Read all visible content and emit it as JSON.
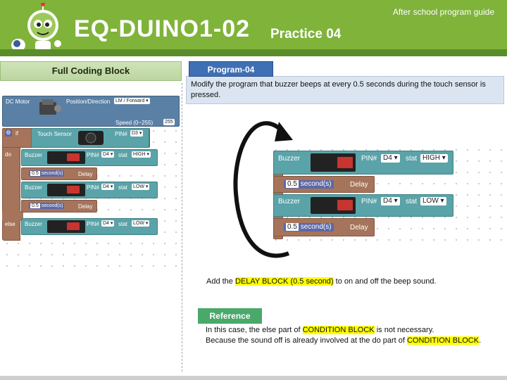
{
  "header": {
    "title": "EQ-DUINO1-02",
    "subtitle": "Practice 04",
    "guide": "After school program guide"
  },
  "left_panel": {
    "tab_label": "Full Coding Block",
    "dc_motor": {
      "label": "DC Motor",
      "pos_label": "Position/Direction",
      "pos_value": "LM / Forward",
      "speed_label": "Speed (0~255)",
      "speed_value": "255"
    },
    "if_block": {
      "if_label": "if",
      "sensor_label": "Touch Sensor",
      "pin_label": "PIN#",
      "pin_value": "D3"
    },
    "do_label": "do",
    "else_label": "else",
    "buzzer_on": {
      "label": "Buzzer",
      "pin_label": "PIN#",
      "pin_value": "D4",
      "stat_label": "stat",
      "stat_value": "HIGH"
    },
    "delay1": {
      "value": "0.5",
      "unit": "second(s)",
      "label": "Delay"
    },
    "buzzer_off": {
      "label": "Buzzer",
      "pin_label": "PIN#",
      "pin_value": "D4",
      "stat_label": "stat",
      "stat_value": "LOW"
    },
    "delay2": {
      "value": "0.5",
      "unit": "second(s)",
      "label": "Delay"
    },
    "buzzer_else": {
      "label": "Buzzer",
      "pin_label": "PIN#",
      "pin_value": "D4",
      "stat_label": "stat",
      "stat_value": "LOW"
    }
  },
  "program": {
    "tab_label": "Program-04",
    "description": "Modify the program that buzzer beeps at every 0.5 seconds during the touch sensor is pressed."
  },
  "loop_blocks": {
    "buzzer_on": {
      "label": "Buzzer",
      "pin_label": "PIN#",
      "pin_value": "D4",
      "stat_label": "stat",
      "stat_value": "HIGH"
    },
    "delay1": {
      "value": "0.5",
      "unit": "second(s)",
      "label": "Delay"
    },
    "buzzer_off": {
      "label": "Buzzer",
      "pin_label": "PIN#",
      "pin_value": "D4",
      "stat_label": "stat",
      "stat_value": "LOW"
    },
    "delay2": {
      "value": "0.5",
      "unit": "second(s)",
      "label": "Delay"
    }
  },
  "instruction": {
    "prefix": "Add the ",
    "highlight": "DELAY BLOCK (0.5 second)",
    "suffix": " to on and off the beep sound."
  },
  "reference": {
    "tab_label": "Reference",
    "line1_prefix": "In this case, the else part of ",
    "line1_highlight": "CONDITION BLOCK",
    "line1_suffix": " is not necessary.",
    "line2_prefix": "Because the sound off is already involved at the do part of ",
    "line2_highlight": "CONDITION BLOCK",
    "line2_suffix": "."
  },
  "colors": {
    "header": "#7fb33a",
    "program_tab": "#3f6fb5",
    "reference_tab": "#4aa86b",
    "highlight": "#ffff00",
    "block_teal": "#5aa3a8",
    "block_brown": "#a5745b"
  },
  "icons": [
    "robot-mascot-icon",
    "loop-arrow-icon",
    "dc-motor-icon",
    "touch-sensor-icon",
    "buzzer-module-icon",
    "gear-icon"
  ]
}
